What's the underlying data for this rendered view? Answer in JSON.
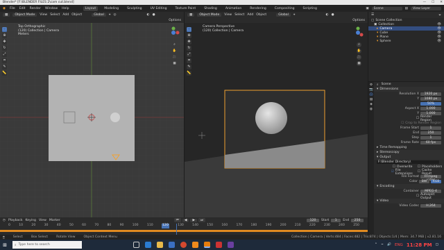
{
  "titlebar": {
    "title": "Blender* [F:\\BLENDER FILES 2\\cam cut.blend]",
    "minimize": "—",
    "maximize": "☐",
    "close": "✕"
  },
  "menubar": {
    "menus": [
      "File",
      "Edit",
      "Render",
      "Window",
      "Help"
    ],
    "workspaces": [
      "Layout",
      "Modeling",
      "Sculpting",
      "UV Editing",
      "Texture Paint",
      "Shading",
      "Animation",
      "Rendering",
      "Compositing",
      "Scripting"
    ],
    "active_workspace": "Layout",
    "scene": "Scene",
    "view_layer": "View Layer"
  },
  "left_viewport": {
    "mode": "Object Mode",
    "menus": [
      "View",
      "Select",
      "Add",
      "Object"
    ],
    "transform": "Global",
    "options": "Options",
    "info_title": "Top Orthographic",
    "info_collection": "(120) Collection | Camera",
    "info_units": "Meters"
  },
  "right_viewport": {
    "mode": "Object Mode",
    "menus": [
      "View",
      "Select",
      "Add",
      "Object"
    ],
    "transform": "Global",
    "options": "Options",
    "info_title": "Camera Perspective",
    "info_collection": "(120) Collection | Camera"
  },
  "outliner": {
    "root": "Scene Collection",
    "items": [
      {
        "name": "Collection",
        "indent": 1,
        "selected": false
      },
      {
        "name": "Camera",
        "indent": 2,
        "selected": true
      },
      {
        "name": "Cube",
        "indent": 2,
        "selected": false
      },
      {
        "name": "Plane",
        "indent": 2,
        "selected": false
      },
      {
        "name": "Sphere",
        "indent": 2,
        "selected": false
      }
    ]
  },
  "properties": {
    "context": "Scene",
    "dimensions_header": "Dimensions",
    "resolution_x_label": "Resolution X",
    "resolution_x": "1920 px",
    "resolution_y_label": "Y",
    "resolution_y": "1080 px",
    "resolution_pct": "50%",
    "aspect_x_label": "Aspect X",
    "aspect_x": "1.000",
    "aspect_y_label": "Y",
    "aspect_y": "1.000",
    "render_region": "Render Region",
    "crop_region": "Crop to Render Region",
    "frame_start_label": "Frame Start",
    "frame_start": "1",
    "frame_end_label": "End",
    "frame_end": "250",
    "frame_step_label": "Step",
    "frame_step": "1",
    "frame_rate_label": "Frame Rate",
    "frame_rate": "60 fps",
    "time_remapping": "Time Remapping",
    "stereoscopy": "Stereoscopy",
    "output_header": "Output",
    "output_path": "F:\\Blender Directory\\",
    "overwrite": "Overwrite",
    "placeholders": "Placeholders",
    "file_extensions": "File Extensions",
    "cache_result": "Cache Result",
    "file_format_label": "File Format",
    "file_format": "FFmpeg video",
    "color_label": "Color",
    "color_bw": "BW",
    "color_rgb": "RGB",
    "encoding_header": "Encoding",
    "container_label": "Container",
    "container": "MPEG-4",
    "autosplit": "Autosplit Output",
    "video_header": "Video",
    "video_codec_label": "Video Codec",
    "video_codec": "H.264"
  },
  "timeline": {
    "menus": [
      "Playback",
      "Keying",
      "View",
      "Marker"
    ],
    "current_frame": "120",
    "start_label": "Start",
    "start": "1",
    "end_label": "End",
    "end": "250",
    "ticks": [
      "0",
      "10",
      "20",
      "30",
      "40",
      "50",
      "60",
      "70",
      "80",
      "90",
      "100",
      "110",
      "120",
      "130",
      "140",
      "150",
      "160",
      "170",
      "180",
      "190",
      "200",
      "210",
      "220",
      "230",
      "240",
      "250"
    ]
  },
  "statusbar": {
    "select": "Select",
    "box_select": "Box Select",
    "rotate_view": "Rotate View",
    "context_menu": "Object Context Menu",
    "stats": "Collection | Camera | Verts:484 | Faces:482 | Tris:874 | Objects:1/4 | Mem: 34.7 MiB | v2.81.16"
  },
  "taskbar": {
    "search_placeholder": "Type here to search",
    "time": "11:28 PM",
    "lang": "ENG"
  },
  "colors": {
    "accent": "#4772b3",
    "selection": "#f0a030",
    "camera_frame": "#f0a030",
    "taskbar": "#1e2a3a"
  }
}
